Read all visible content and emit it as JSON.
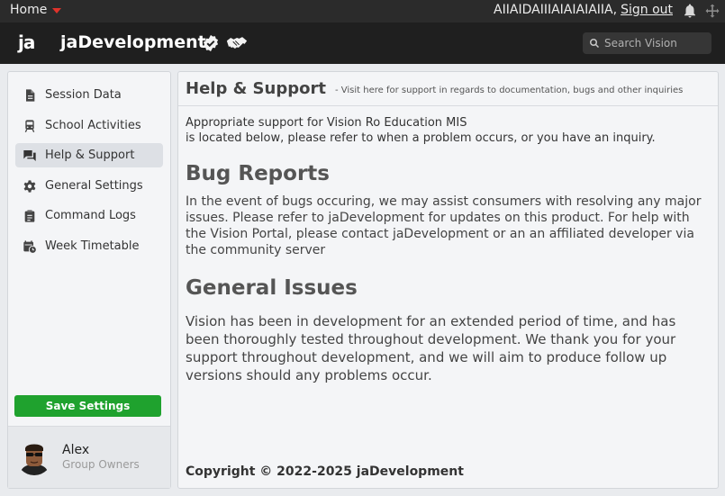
{
  "topbar": {
    "home_label": "Home",
    "username": "AIIAIDAIIIAIAIAIAIIA,",
    "signout_label": "Sign out"
  },
  "appbar": {
    "logo_text": "ja",
    "brand_name": "jaDevelopment",
    "search_placeholder": "Search Vision"
  },
  "sidebar": {
    "items": [
      {
        "label": "Session Data",
        "icon": "document-icon"
      },
      {
        "label": "School Activities",
        "icon": "train-icon"
      },
      {
        "label": "Help & Support",
        "icon": "chat-icon",
        "active": true
      },
      {
        "label": "General Settings",
        "icon": "gear-icon"
      },
      {
        "label": "Command Logs",
        "icon": "clipboard-icon"
      },
      {
        "label": "Week Timetable",
        "icon": "calendar-clock-icon"
      }
    ],
    "save_label": "Save Settings",
    "profile": {
      "name": "Alex",
      "role": "Group Owners"
    }
  },
  "main": {
    "title": "Help & Support",
    "subtitle": "- Visit here for support in regards to documentation, bugs and other inquiries",
    "intro_line1": "Appropriate support for Vision Ro Education MIS",
    "intro_line2": "is located below, please refer to when a problem occurs, or you have an inquiry.",
    "bug_heading": "Bug Reports",
    "bug_text": "In the event of bugs occuring, we may assist consumers with resolving any major issues. Please refer to jaDevelopment for updates on this product. For help with the Vision Portal, please contact jaDevelopment or an an affiliated developer via the community server",
    "general_heading": "General Issues",
    "general_text": "Vision has been in development for an extended period of time, and has been thoroughly tested throughout development. We thank you for your support throughout development, and we will aim to produce follow up versions should any problems occur.",
    "copyright": "Copyright © 2022-2025 jaDevelopment"
  },
  "colors": {
    "accent_green": "#1fa22e",
    "topbar_bg": "#2b2b2b",
    "appbar_bg": "#1f1f1f",
    "home_caret": "#e0332b"
  }
}
